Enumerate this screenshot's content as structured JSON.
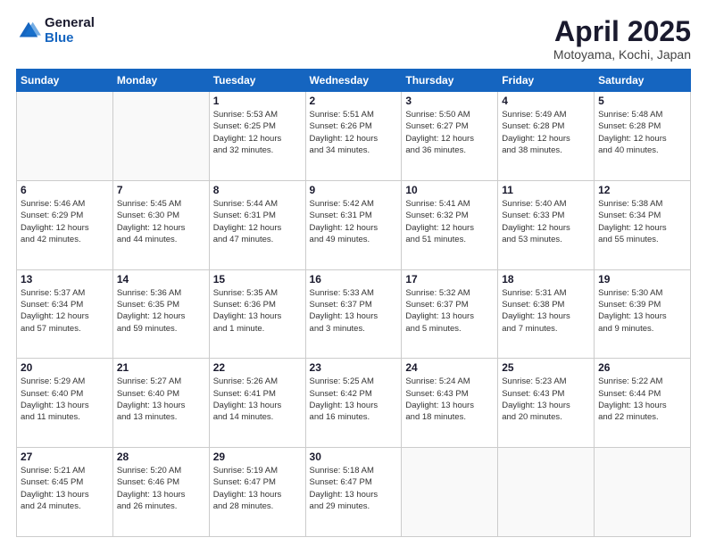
{
  "logo": {
    "general": "General",
    "blue": "Blue"
  },
  "header": {
    "month": "April 2025",
    "location": "Motoyama, Kochi, Japan"
  },
  "weekdays": [
    "Sunday",
    "Monday",
    "Tuesday",
    "Wednesday",
    "Thursday",
    "Friday",
    "Saturday"
  ],
  "weeks": [
    [
      {
        "day": "",
        "info": ""
      },
      {
        "day": "",
        "info": ""
      },
      {
        "day": "1",
        "info": "Sunrise: 5:53 AM\nSunset: 6:25 PM\nDaylight: 12 hours\nand 32 minutes."
      },
      {
        "day": "2",
        "info": "Sunrise: 5:51 AM\nSunset: 6:26 PM\nDaylight: 12 hours\nand 34 minutes."
      },
      {
        "day": "3",
        "info": "Sunrise: 5:50 AM\nSunset: 6:27 PM\nDaylight: 12 hours\nand 36 minutes."
      },
      {
        "day": "4",
        "info": "Sunrise: 5:49 AM\nSunset: 6:28 PM\nDaylight: 12 hours\nand 38 minutes."
      },
      {
        "day": "5",
        "info": "Sunrise: 5:48 AM\nSunset: 6:28 PM\nDaylight: 12 hours\nand 40 minutes."
      }
    ],
    [
      {
        "day": "6",
        "info": "Sunrise: 5:46 AM\nSunset: 6:29 PM\nDaylight: 12 hours\nand 42 minutes."
      },
      {
        "day": "7",
        "info": "Sunrise: 5:45 AM\nSunset: 6:30 PM\nDaylight: 12 hours\nand 44 minutes."
      },
      {
        "day": "8",
        "info": "Sunrise: 5:44 AM\nSunset: 6:31 PM\nDaylight: 12 hours\nand 47 minutes."
      },
      {
        "day": "9",
        "info": "Sunrise: 5:42 AM\nSunset: 6:31 PM\nDaylight: 12 hours\nand 49 minutes."
      },
      {
        "day": "10",
        "info": "Sunrise: 5:41 AM\nSunset: 6:32 PM\nDaylight: 12 hours\nand 51 minutes."
      },
      {
        "day": "11",
        "info": "Sunrise: 5:40 AM\nSunset: 6:33 PM\nDaylight: 12 hours\nand 53 minutes."
      },
      {
        "day": "12",
        "info": "Sunrise: 5:38 AM\nSunset: 6:34 PM\nDaylight: 12 hours\nand 55 minutes."
      }
    ],
    [
      {
        "day": "13",
        "info": "Sunrise: 5:37 AM\nSunset: 6:34 PM\nDaylight: 12 hours\nand 57 minutes."
      },
      {
        "day": "14",
        "info": "Sunrise: 5:36 AM\nSunset: 6:35 PM\nDaylight: 12 hours\nand 59 minutes."
      },
      {
        "day": "15",
        "info": "Sunrise: 5:35 AM\nSunset: 6:36 PM\nDaylight: 13 hours\nand 1 minute."
      },
      {
        "day": "16",
        "info": "Sunrise: 5:33 AM\nSunset: 6:37 PM\nDaylight: 13 hours\nand 3 minutes."
      },
      {
        "day": "17",
        "info": "Sunrise: 5:32 AM\nSunset: 6:37 PM\nDaylight: 13 hours\nand 5 minutes."
      },
      {
        "day": "18",
        "info": "Sunrise: 5:31 AM\nSunset: 6:38 PM\nDaylight: 13 hours\nand 7 minutes."
      },
      {
        "day": "19",
        "info": "Sunrise: 5:30 AM\nSunset: 6:39 PM\nDaylight: 13 hours\nand 9 minutes."
      }
    ],
    [
      {
        "day": "20",
        "info": "Sunrise: 5:29 AM\nSunset: 6:40 PM\nDaylight: 13 hours\nand 11 minutes."
      },
      {
        "day": "21",
        "info": "Sunrise: 5:27 AM\nSunset: 6:40 PM\nDaylight: 13 hours\nand 13 minutes."
      },
      {
        "day": "22",
        "info": "Sunrise: 5:26 AM\nSunset: 6:41 PM\nDaylight: 13 hours\nand 14 minutes."
      },
      {
        "day": "23",
        "info": "Sunrise: 5:25 AM\nSunset: 6:42 PM\nDaylight: 13 hours\nand 16 minutes."
      },
      {
        "day": "24",
        "info": "Sunrise: 5:24 AM\nSunset: 6:43 PM\nDaylight: 13 hours\nand 18 minutes."
      },
      {
        "day": "25",
        "info": "Sunrise: 5:23 AM\nSunset: 6:43 PM\nDaylight: 13 hours\nand 20 minutes."
      },
      {
        "day": "26",
        "info": "Sunrise: 5:22 AM\nSunset: 6:44 PM\nDaylight: 13 hours\nand 22 minutes."
      }
    ],
    [
      {
        "day": "27",
        "info": "Sunrise: 5:21 AM\nSunset: 6:45 PM\nDaylight: 13 hours\nand 24 minutes."
      },
      {
        "day": "28",
        "info": "Sunrise: 5:20 AM\nSunset: 6:46 PM\nDaylight: 13 hours\nand 26 minutes."
      },
      {
        "day": "29",
        "info": "Sunrise: 5:19 AM\nSunset: 6:47 PM\nDaylight: 13 hours\nand 28 minutes."
      },
      {
        "day": "30",
        "info": "Sunrise: 5:18 AM\nSunset: 6:47 PM\nDaylight: 13 hours\nand 29 minutes."
      },
      {
        "day": "",
        "info": ""
      },
      {
        "day": "",
        "info": ""
      },
      {
        "day": "",
        "info": ""
      }
    ]
  ]
}
